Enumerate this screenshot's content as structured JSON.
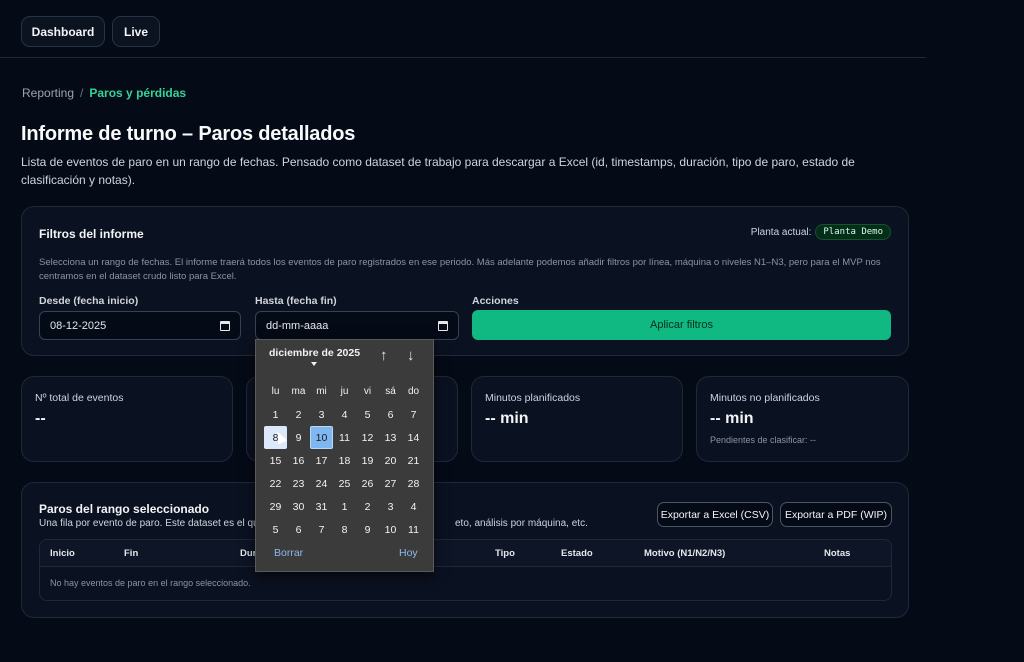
{
  "nav": {
    "dashboard_label": "Dashboard",
    "live_label": "Live"
  },
  "breadcrumb": {
    "root": "Reporting",
    "separator": "/",
    "current": "Paros y pérdidas"
  },
  "page": {
    "title": "Informe de turno – Paros detallados",
    "description": "Lista de eventos de paro en un rango de fechas. Pensado como dataset de trabajo para descargar a Excel (id, timestamps, duración, tipo de paro, estado de clasificación y notas)."
  },
  "filters": {
    "title": "Filtros del informe",
    "plant_label": "Planta actual:",
    "plant_value": "Planta Demo",
    "help": "Selecciona un rango de fechas. El informe traerá todos los eventos de paro registrados en ese periodo. Más adelante podemos añadir filtros por línea, máquina o niveles N1–N3, pero para el MVP nos centramos en el dataset crudo listo para Excel.",
    "from_label": "Desde (fecha inicio)",
    "from_value": "08-12-2025",
    "to_label": "Hasta (fecha fin)",
    "to_placeholder": "dd-mm-aaaa",
    "actions_label": "Acciones",
    "apply_label": "Aplicar filtros"
  },
  "stats": [
    {
      "label": "Nº total de eventos",
      "value": "--",
      "sub": ""
    },
    {
      "label": "",
      "value": "",
      "sub": ""
    },
    {
      "label": "Minutos planificados",
      "value": "-- min",
      "sub": ""
    },
    {
      "label": "Minutos no planificados",
      "value": "-- min",
      "sub": "Pendientes de clasificar: --"
    }
  ],
  "table": {
    "title": "Paros del rango seleccionado",
    "subtitle_left": "Una fila por evento de paro. Este dataset es el que",
    "subtitle_right": "eto, análisis por máquina, etc.",
    "export_csv_label": "Exportar a Excel (CSV)",
    "export_pdf_label": "Exportar a PDF (WIP)",
    "columns": [
      "Inicio",
      "Fin",
      "Dur",
      "Tipo",
      "Estado",
      "Motivo (N1/N2/N3)",
      "Notas"
    ],
    "empty_text": "No hay eventos de paro en el rango seleccionado."
  },
  "datepicker": {
    "month_label": "diciembre de 2025",
    "prev_icon": "arrow-up-icon",
    "next_icon": "arrow-down-icon",
    "weekdays": [
      "lu",
      "ma",
      "mi",
      "ju",
      "vi",
      "sá",
      "do"
    ],
    "days": [
      "1",
      "2",
      "3",
      "4",
      "5",
      "6",
      "7",
      "8",
      "9",
      "10",
      "11",
      "12",
      "13",
      "14",
      "15",
      "16",
      "17",
      "18",
      "19",
      "20",
      "21",
      "22",
      "23",
      "24",
      "25",
      "26",
      "27",
      "28",
      "29",
      "30",
      "31",
      "1",
      "2",
      "3",
      "4",
      "5",
      "6",
      "7",
      "8",
      "9",
      "10",
      "11"
    ],
    "hover_day": "8",
    "today_day": "10",
    "clear_label": "Borrar",
    "today_label": "Hoy"
  }
}
